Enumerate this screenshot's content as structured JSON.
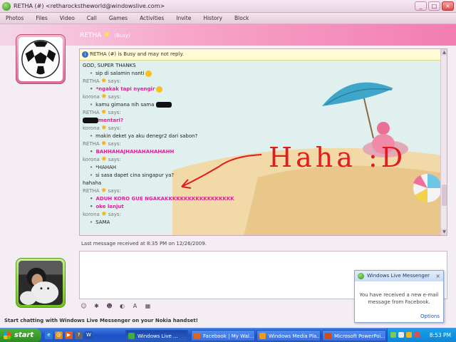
{
  "window": {
    "title": "RETHA (#) <retharockstheworld@windowslive.com>",
    "buttons": [
      "_",
      "□",
      "×"
    ]
  },
  "menu": [
    "Photos",
    "Files",
    "Video",
    "Call",
    "Games",
    "Activities",
    "Invite",
    "History",
    "Block"
  ],
  "contact": {
    "name": "RETHA",
    "status": "(Busy)"
  },
  "notice": "RETHA (#) is Busy and may not reply.",
  "messages": [
    {
      "text": "GOD, SUPER THANKS",
      "kind": "plain"
    },
    {
      "text": "sip di salamin nanti",
      "kind": "bullet",
      "smile": true
    },
    {
      "text": "RETHA",
      "kind": "says",
      "suffix": "says:"
    },
    {
      "text": "*ngakak tapi nyengir",
      "kind": "pink",
      "smile": true
    },
    {
      "text": "korona",
      "kind": "says",
      "suffix": "says:"
    },
    {
      "text": "kamu gimana nih sama",
      "kind": "bullet",
      "redact": true
    },
    {
      "text": "RETHA",
      "kind": "says",
      "suffix": "says:"
    },
    {
      "text": "mentari?",
      "kind": "pink",
      "redactBefore": true
    },
    {
      "text": "korona",
      "kind": "says",
      "suffix": "says:"
    },
    {
      "text": "makin deket ya aku denegr2 dari sabon?",
      "kind": "bullet"
    },
    {
      "text": "RETHA",
      "kind": "says",
      "suffix": "says:"
    },
    {
      "text": "BAHHAHAJHAHAHAHAHAHH",
      "kind": "pink"
    },
    {
      "text": "korona",
      "kind": "says",
      "suffix": "says:"
    },
    {
      "text": "*HAHAH",
      "kind": "bullet"
    },
    {
      "text": "si sasa dapet cina singapur ya?",
      "kind": "bullet"
    },
    {
      "text": "hahaha",
      "kind": "plain"
    },
    {
      "text": "RETHA",
      "kind": "says",
      "suffix": "says:"
    },
    {
      "text": "ADUH KORO GUE NGAKAKKKKKKKKKKKKKKKKKK",
      "kind": "pink"
    },
    {
      "text": "oke lanjut",
      "kind": "pink"
    },
    {
      "text": "korona",
      "kind": "says",
      "suffix": "says:"
    },
    {
      "text": "SAMA",
      "kind": "bullet"
    }
  ],
  "scrollbar": {
    "up": "▲",
    "down": "▼"
  },
  "annotation": "Haha :D",
  "last_message": "Last message received at 8:35 PM on 12/26/2009.",
  "input_toolbar": [
    "☺",
    "✱",
    "☻",
    "◐",
    "A",
    "▦"
  ],
  "nokia_promo": "Start chatting with Windows Live Messenger on your Nokia handset!",
  "toast": {
    "title": "Windows Live Messenger",
    "close": "×",
    "body": "You have received a new e-mail message from Facebook.",
    "options": "Options"
  },
  "taskbar": {
    "start": "start",
    "quicklaunch": [
      "e",
      "@",
      "▶",
      "?",
      "W"
    ],
    "tasks": [
      {
        "label": "Windows Live ...",
        "color": "#3fae3f",
        "active": true
      },
      {
        "label": "Facebook | My Wal...",
        "color": "#e0661f",
        "active": false
      },
      {
        "label": "Windows Media Pla...",
        "color": "#f09a1a",
        "active": false
      },
      {
        "label": "Microsoft PowerPoi...",
        "color": "#d44a1c",
        "active": false
      }
    ],
    "clock": "8:53 PM"
  }
}
